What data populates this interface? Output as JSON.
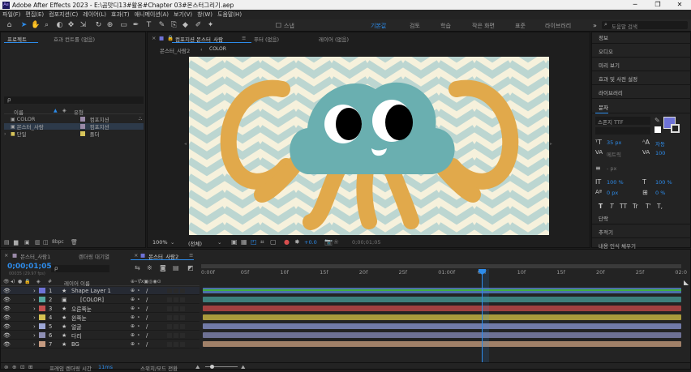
{
  "titlebar": {
    "title": "Adobe After Effects 2023 - E:\\곰맛디13#활용#Chapter 03#몬스터그리기.aep",
    "minimize": "─",
    "restore": "❐",
    "close": "✕"
  },
  "menu": [
    "파일(F)",
    "편집(E)",
    "컴포지션(C)",
    "레이어(L)",
    "효과(T)",
    "애니메이션(A)",
    "보기(V)",
    "창(W)",
    "도움말(H)"
  ],
  "toolbar": {
    "snap": "스냅",
    "workspaces": [
      "기본값",
      "검토",
      "학습",
      "작은 화면",
      "표준",
      "라이브러리"
    ],
    "search_placeholder": "도움말 검색"
  },
  "project": {
    "tabs": [
      "프로젝트",
      "효과 컨트롤 (없음)"
    ],
    "search_value": "ρ",
    "cols": {
      "name": "이름",
      "type": "유형"
    },
    "items": [
      {
        "icon": "comp-icon",
        "name": "COLOR",
        "type": "컴포지션",
        "color": "#9a8aa8"
      },
      {
        "icon": "comp-icon",
        "name": "몬스터_사람",
        "type": "컴포지션",
        "color": "#9a8aa8"
      },
      {
        "icon": "folder-icon",
        "name": "단일",
        "type": "폴더",
        "color": "#d7c45a"
      }
    ],
    "footer": "8bpc"
  },
  "viewer": {
    "tabs": [
      "컴포지션 몬스터_사람",
      "푸터 (없음)",
      "레이어 (없음)"
    ],
    "breadcrumb": [
      "몬스터_사람2",
      "COLOR"
    ],
    "zoom": "100%",
    "resolution": "(전체)",
    "exposure": "+0.0",
    "timecode": "0;00;01;05"
  },
  "rightpanel": {
    "items": [
      "정보",
      "오디오",
      "미리 보기",
      "효과 및 사전 설정",
      "라이브러리"
    ],
    "char_title": "문자",
    "font": "스폰지 TTF",
    "size": "35 px",
    "leading": "자동",
    "kerning": "메트릭",
    "tracking": "100",
    "stroke": "- px",
    "vscale": "100 %",
    "hscale": "100 %",
    "baseline": "0 px",
    "tsume": "0 %",
    "styles": [
      "T",
      "T",
      "TT",
      "Tr",
      "T'",
      "T,"
    ],
    "bottom": [
      "단락",
      "추적기",
      "내용 인식 채우기"
    ]
  },
  "timeline": {
    "tabs": [
      "몬스터_사람1",
      "렌더링 대기열",
      "몬스터_사람2"
    ],
    "timecode": "0;00;01;05",
    "subtime": "00035 (29.97 fps)",
    "search_value": "ρ",
    "col_label": "레이어 이름",
    "layers": [
      {
        "num": "1",
        "name": "Shape Layer 1",
        "color": "#6e72d6",
        "barcolor": "#4c70a8"
      },
      {
        "num": "2",
        "name": "[COLOR]",
        "color": "#55a7a0",
        "barcolor": "#3d7f7c"
      },
      {
        "num": "3",
        "name": "오른쪽눈",
        "color": "#c55050",
        "barcolor": "#a14040"
      },
      {
        "num": "4",
        "name": "왼쪽눈",
        "color": "#d4c050",
        "barcolor": "#a89a3c"
      },
      {
        "num": "5",
        "name": "얼굴",
        "color": "#9da7d6",
        "barcolor": "#717aa7"
      },
      {
        "num": "6",
        "name": "다리",
        "color": "#8e8fb4",
        "barcolor": "#6e7194"
      },
      {
        "num": "7",
        "name": "BG",
        "color": "#c59a80",
        "barcolor": "#a08068"
      }
    ],
    "ticks": [
      "0:00f",
      "05f",
      "10f",
      "15f",
      "20f",
      "25f",
      "01:00f",
      "05f",
      "10f",
      "15f",
      "20f",
      "25f",
      "02:0"
    ],
    "footer": "프레임 렌더링 시간",
    "footer_time": "11ms",
    "toggle": "스위치/모드 전환"
  },
  "colors": {
    "accent": "#2d8ceb",
    "bg_cream": "#f6f1dc",
    "chevron": "#bcd6d1",
    "monster": "#6aafb0",
    "tentacle": "#e1a94b"
  }
}
